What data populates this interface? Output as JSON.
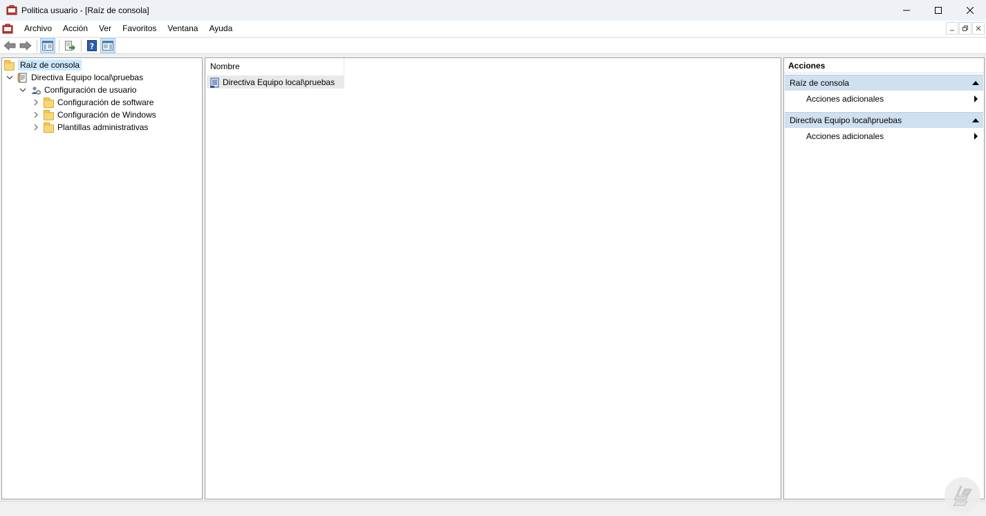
{
  "window": {
    "title": "Politica usuario - [Raíz de consola]"
  },
  "menu": {
    "items": [
      "Archivo",
      "Acción",
      "Ver",
      "Favoritos",
      "Ventana",
      "Ayuda"
    ]
  },
  "tree": {
    "root": "Raíz de consola",
    "policy": "Directiva Equipo local\\pruebas",
    "user_config": "Configuración de usuario",
    "children": [
      "Configuración de software",
      "Configuración de Windows",
      "Plantillas administrativas"
    ]
  },
  "list": {
    "column_header": "Nombre",
    "rows": [
      "Directiva Equipo local\\pruebas"
    ]
  },
  "actions": {
    "header": "Acciones",
    "groups": [
      {
        "title": "Raíz de consola",
        "item": "Acciones adicionales"
      },
      {
        "title": "Directiva Equipo local\\pruebas",
        "item": "Acciones adicionales"
      }
    ]
  },
  "icons": {
    "app": "mmc-console-icon",
    "back": "back-arrow-icon",
    "forward": "forward-arrow-icon",
    "show_tree": "show-hide-console-tree-icon",
    "export": "export-list-icon",
    "help": "help-icon",
    "action_pane": "show-hide-action-pane-icon"
  },
  "colors": {
    "selection": "#cce8ff",
    "action_group": "#cfe0f0",
    "folder": "#f8d775"
  }
}
